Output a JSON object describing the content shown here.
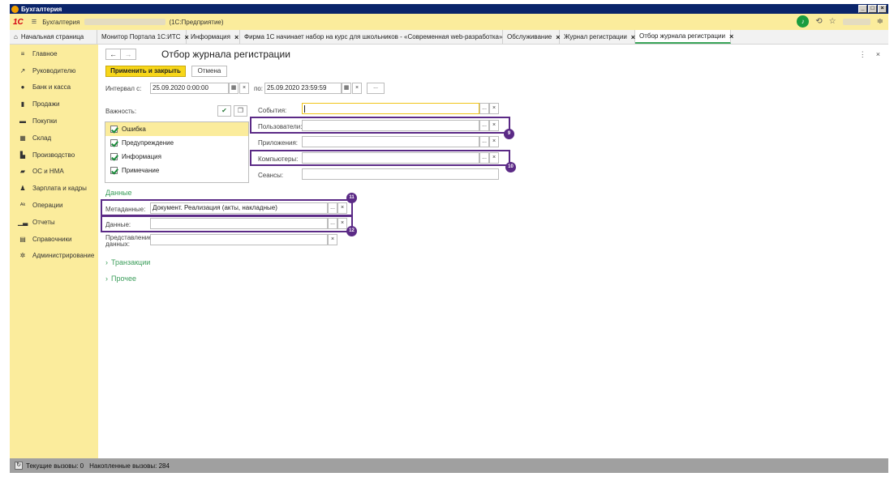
{
  "window": {
    "title": "Бухгалтерия",
    "controls": [
      "_",
      "□",
      "×"
    ]
  },
  "appbar": {
    "logo": "1С",
    "app_name": "Бухгалтерия",
    "platform": "(1С:Предприятие)",
    "bell_icon": "bell-icon",
    "icons": [
      "history-icon",
      "star-icon",
      "settings-icon"
    ]
  },
  "tabs": [
    {
      "label": "Начальная страница",
      "closable": false
    },
    {
      "label": "Монитор Портала 1С:ИТС",
      "closable": true
    },
    {
      "label": "Информация",
      "closable": true
    },
    {
      "label": "Фирма 1С начинает набор на курс для школьников - «Современная web-разработка»",
      "closable": true
    },
    {
      "label": "Обслуживание",
      "closable": true
    },
    {
      "label": "Журнал регистрации",
      "closable": true
    },
    {
      "label": "Отбор журнала регистрации",
      "closable": true,
      "active": true
    }
  ],
  "sidebar": {
    "items": [
      {
        "label": "Главное",
        "icon": "≡"
      },
      {
        "label": "Руководителю",
        "icon": "↗"
      },
      {
        "label": "Банк и касса",
        "icon": "●"
      },
      {
        "label": "Продажи",
        "icon": "▮"
      },
      {
        "label": "Покупки",
        "icon": "▬"
      },
      {
        "label": "Склад",
        "icon": "▦"
      },
      {
        "label": "Производство",
        "icon": "▙"
      },
      {
        "label": "ОС и НМА",
        "icon": "▰"
      },
      {
        "label": "Зарплата и кадры",
        "icon": "♟"
      },
      {
        "label": "Операции",
        "icon": "ᴬᵏ"
      },
      {
        "label": "Отчеты",
        "icon": "▁▃"
      },
      {
        "label": "Справочники",
        "icon": "▤"
      },
      {
        "label": "Администрирование",
        "icon": "✲"
      }
    ]
  },
  "form": {
    "title": "Отбор журнала регистрации",
    "apply_button": "Применить и закрыть",
    "cancel_button": "Отмена",
    "interval_from_label": "Интервал с:",
    "interval_from": "25.09.2020  0:00:00",
    "interval_to_label": "по:",
    "interval_to": "25.09.2020 23:59:59",
    "more_button": "...",
    "importance_label": "Важность:",
    "importance": [
      {
        "label": "Ошибка",
        "checked": true,
        "selected": true
      },
      {
        "label": "Предупреждение",
        "checked": true
      },
      {
        "label": "Информация",
        "checked": true
      },
      {
        "label": "Примечание",
        "checked": true
      }
    ],
    "events_label": "События:",
    "users_label": "Пользователи:",
    "apps_label": "Приложения:",
    "computers_label": "Компьютеры:",
    "sessions_label": "Сеансы:",
    "data_section": "Данные",
    "metadata_label": "Метаданные:",
    "metadata_value": "Документ. Реализация (акты, накладные)",
    "data_label": "Данные:",
    "data_repr_label": "Представление данных:",
    "transactions_group": "Транзакции",
    "other_group": "Прочее",
    "badges": [
      "9",
      "10",
      "11",
      "12"
    ]
  },
  "status": {
    "current_calls": "Текущие вызовы: 0",
    "accumulated_calls": "Накопленные вызовы: 284"
  },
  "colors": {
    "sidebar_bg": "#fbec9c",
    "accent_yellow": "#f7d619",
    "highlight_purple": "#5b2a86",
    "section_green": "#3a9d5a"
  }
}
